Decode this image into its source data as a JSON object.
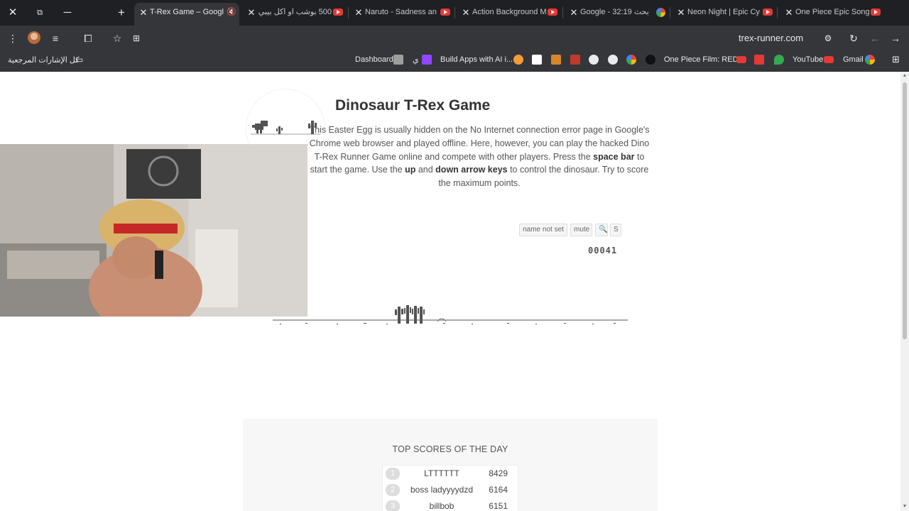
{
  "browser": {
    "tabs": [
      {
        "title": "T-Rex Game – Googl",
        "active": true,
        "icon": "mute-icon"
      },
      {
        "title": "500 بوشب او اكل بيبي",
        "icon": "youtube-icon"
      },
      {
        "title": "Naruto - Sadness an",
        "icon": "youtube-icon"
      },
      {
        "title": "Action Background M",
        "icon": "youtube-icon"
      },
      {
        "title": "Google - بحث 32:19",
        "icon": "google-icon"
      },
      {
        "title": "Neon Night | Epic Cy",
        "icon": "youtube-icon"
      },
      {
        "title": "One Piece Epic Song",
        "icon": "youtube-icon"
      }
    ],
    "url": "trex-runner.com",
    "bookmarks": {
      "all_bookmarks": "كل الإشارات المرجعية",
      "dashboard": "Dashboard",
      "arabic_item": "ي",
      "build_apps": "Build Apps with AI i...",
      "one_piece": "One Piece Film: RED...",
      "youtube": "YouTube",
      "gmail": "Gmail"
    }
  },
  "page": {
    "title": "Dinosaur T-Rex Game",
    "intro_1": "This Easter Egg is usually hidden on the No Internet connection error page in Google's Chrome web browser and played offline. Here, however, you can play the hacked Dino T-Rex Runner Game online and compete with other players. Press the ",
    "intro_space": "space bar",
    "intro_2": " to start the game. Use the ",
    "intro_up": "up",
    "intro_3": " and ",
    "intro_down": "down arrow keys",
    "intro_4": " to control the dinosaur. Try to score the maximum points.",
    "controls": {
      "name": "name not set",
      "mute": "mute",
      "zoom": "🔍",
      "s": "S"
    },
    "score": "00041",
    "top_scores_title": "TOP SCORES OF THE DAY",
    "top_scores": [
      {
        "rank": "1",
        "name": "LTTTTTT",
        "score": "8429"
      },
      {
        "rank": "2",
        "name": "boss ladyyyydzd",
        "score": "6164"
      },
      {
        "rank": "3",
        "name": "billbob",
        "score": "6151"
      }
    ]
  },
  "colors": {
    "tabstrip": "#1f2023",
    "toolbar": "#35363a",
    "game_ink": "#535353"
  }
}
